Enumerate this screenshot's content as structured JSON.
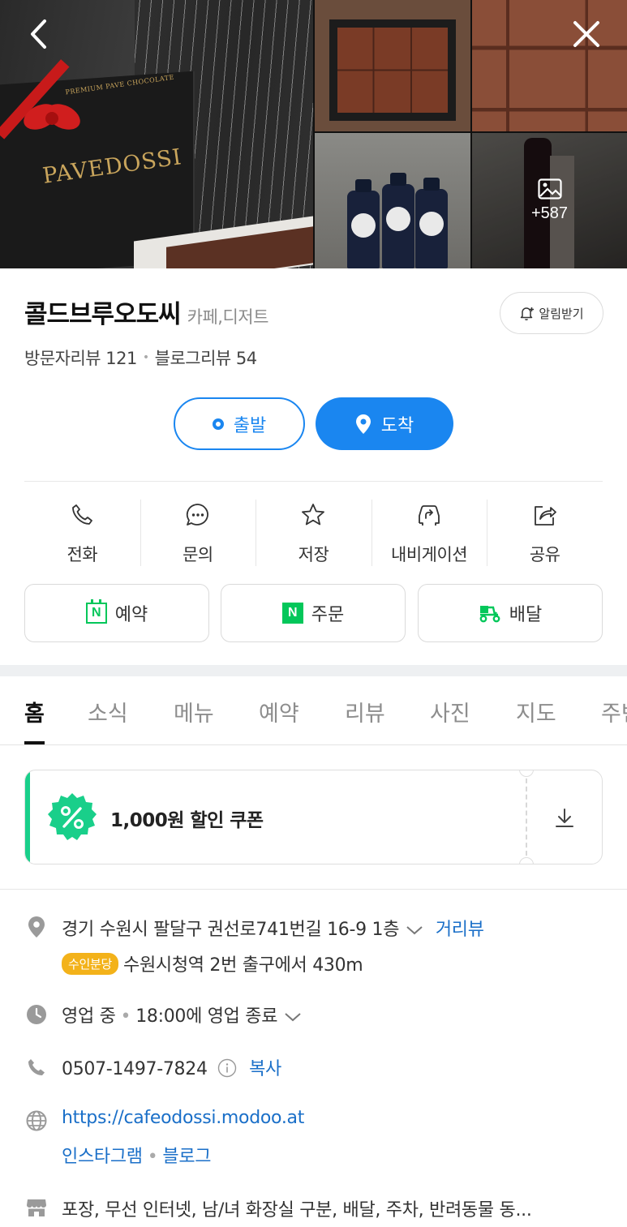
{
  "gallery": {
    "brand_text": "PAVEDOSSI",
    "brand_sub": "PREMIUM PAVE CHOCOLATE",
    "more_count": "+587"
  },
  "header": {
    "name": "콜드브루오도씨",
    "category": "카페,디저트",
    "alarm_label": "알림받기",
    "visitor_reviews": "방문자리뷰 121",
    "blog_reviews": "블로그리뷰 54"
  },
  "route": {
    "depart_label": "출발",
    "arrive_label": "도착"
  },
  "actions": [
    "전화",
    "문의",
    "저장",
    "내비게이션",
    "공유"
  ],
  "services": {
    "reserve": "예약",
    "order": "주문",
    "delivery": "배달"
  },
  "tabs": [
    "홈",
    "소식",
    "메뉴",
    "예약",
    "리뷰",
    "사진",
    "지도",
    "주변"
  ],
  "coupon": {
    "text": "1,000원 할인 쿠폰"
  },
  "info": {
    "address": "경기 수원시 팔달구 권선로741번길 16-9 1층",
    "street_view": "거리뷰",
    "subway_line": "수인분당",
    "subway_desc": "수원시청역 2번 출구에서 430m",
    "status": "영업 중",
    "hours": "18:00에 영업 종료",
    "phone": "0507-1497-7824",
    "copy_label": "복사",
    "website": "https://cafeodossi.modoo.at",
    "instagram": "인스타그램",
    "blog": "블로그",
    "amenities": "포장, 무선 인터넷, 남/녀 화장실 구분, 배달, 주차, 반려동물 동..."
  },
  "colors": {
    "accent": "#1a86f0",
    "naver_green": "#03c75a",
    "coupon_stripe": "#19cf8a",
    "link": "#1a6fc8"
  }
}
